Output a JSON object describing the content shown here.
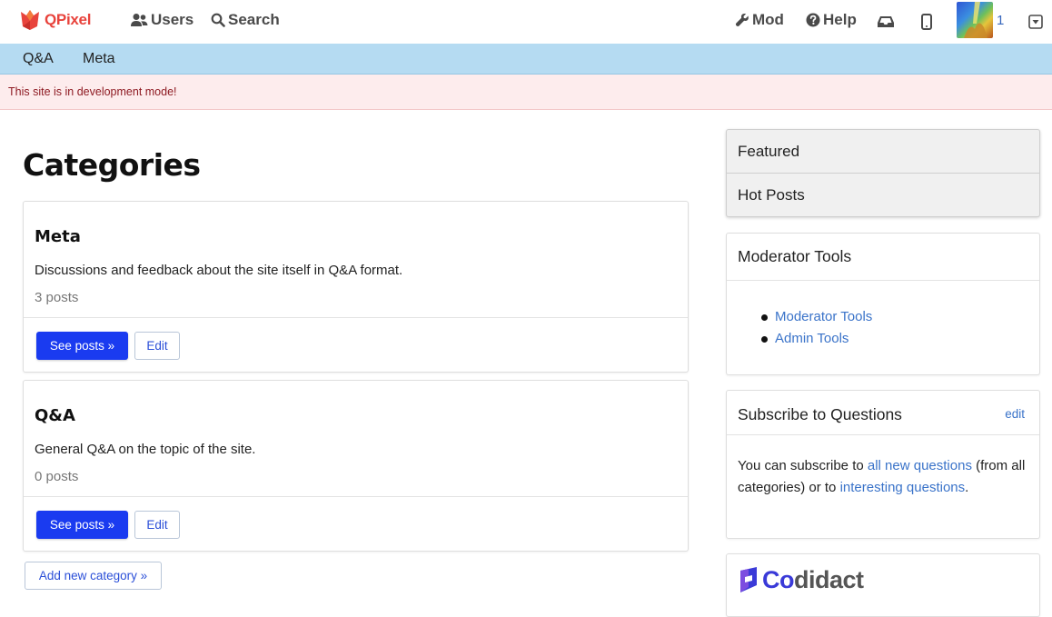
{
  "header": {
    "logo_text": "QPixel",
    "nav_users": "Users",
    "nav_search": "Search",
    "nav_mod": "Mod",
    "nav_help": "Help",
    "reputation": "1"
  },
  "category_bar": {
    "tabs": [
      {
        "label": "Q&A"
      },
      {
        "label": "Meta"
      }
    ]
  },
  "notice": {
    "text": "This site is in development mode!"
  },
  "main": {
    "title": "Categories",
    "categories": [
      {
        "name": "Meta",
        "description": "Discussions and feedback about the site itself in Q&A format.",
        "count": "3 posts",
        "see_posts": "See posts »",
        "edit": "Edit"
      },
      {
        "name": "Q&A",
        "description": "General Q&A on the topic of the site.",
        "count": "0 posts",
        "see_posts": "See posts »",
        "edit": "Edit"
      }
    ],
    "add_category": "Add new category »"
  },
  "sidebar": {
    "featured": "Featured",
    "hot_posts": "Hot Posts",
    "mod_tools_title": "Moderator Tools",
    "mod_links": [
      {
        "label": "Moderator Tools"
      },
      {
        "label": "Admin Tools"
      }
    ],
    "subscribe_title": "Subscribe to Questions",
    "subscribe_edit": "edit",
    "subscribe_text_1": "You can subscribe to ",
    "subscribe_link_1": "all new questions",
    "subscribe_text_2": " (from all categories) or to ",
    "subscribe_link_2": "interesting questions",
    "subscribe_text_3": ".",
    "codidact_1": "Co",
    "codidact_2": "didact"
  },
  "colors": {
    "brand": "#e8433c",
    "category_bar": "#b5dbf2",
    "primary_button": "#1a3bf0",
    "link": "#3a73c9",
    "notice_bg": "#fdeced",
    "notice_text": "#8e1b23"
  },
  "icons": {
    "users": "users-icon",
    "search": "search-icon",
    "mod": "wrench-icon",
    "help": "question-circle-icon",
    "inbox": "inbox-icon",
    "mobile": "mobile-icon",
    "menu": "caret-square-down-icon"
  }
}
